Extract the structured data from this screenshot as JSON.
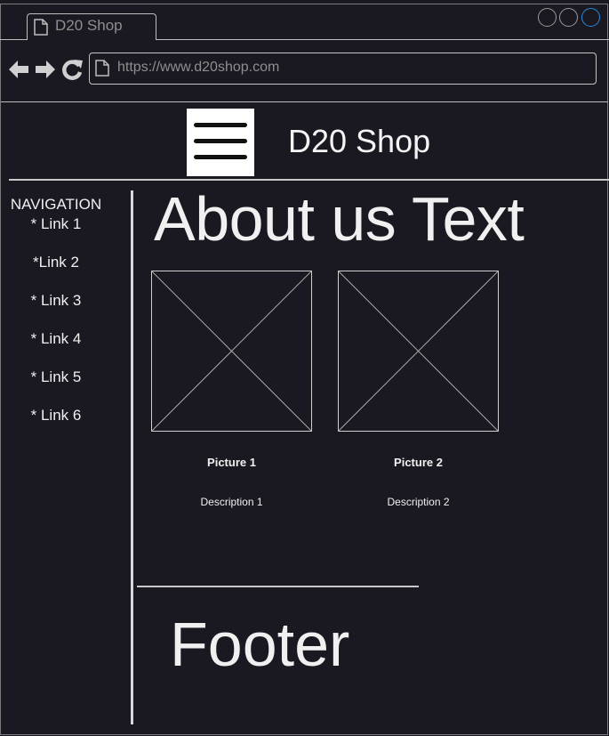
{
  "browser": {
    "tab_title": "D20 Shop",
    "url": "https://www.d20shop.com",
    "icons": {
      "tab": "document-icon",
      "back": "back-arrow-icon",
      "forward": "forward-arrow-icon",
      "reload": "reload-icon",
      "url": "document-icon"
    },
    "window_controls": [
      "minimize",
      "maximize",
      "close"
    ],
    "accent_color": "#2a8ad8"
  },
  "header": {
    "menu_icon": "hamburger-menu-icon",
    "site_title": "D20 Shop"
  },
  "sidebar": {
    "title": "NAVIGATION",
    "links": [
      "* Link 1",
      "*Link 2",
      "* Link 3",
      "* Link 4",
      "* Link 5",
      "* Link 6"
    ]
  },
  "main": {
    "heading": "About us Text",
    "pictures": [
      {
        "label": "Picture 1",
        "description": "Description 1",
        "icon": "image-placeholder-icon"
      },
      {
        "label": "Picture 2",
        "description": "Description 2",
        "icon": "image-placeholder-icon"
      }
    ]
  },
  "footer": {
    "text": "Footer"
  },
  "colors": {
    "background": "#1a1820",
    "foreground": "#f0f0f0",
    "muted": "#8f8f8f"
  }
}
